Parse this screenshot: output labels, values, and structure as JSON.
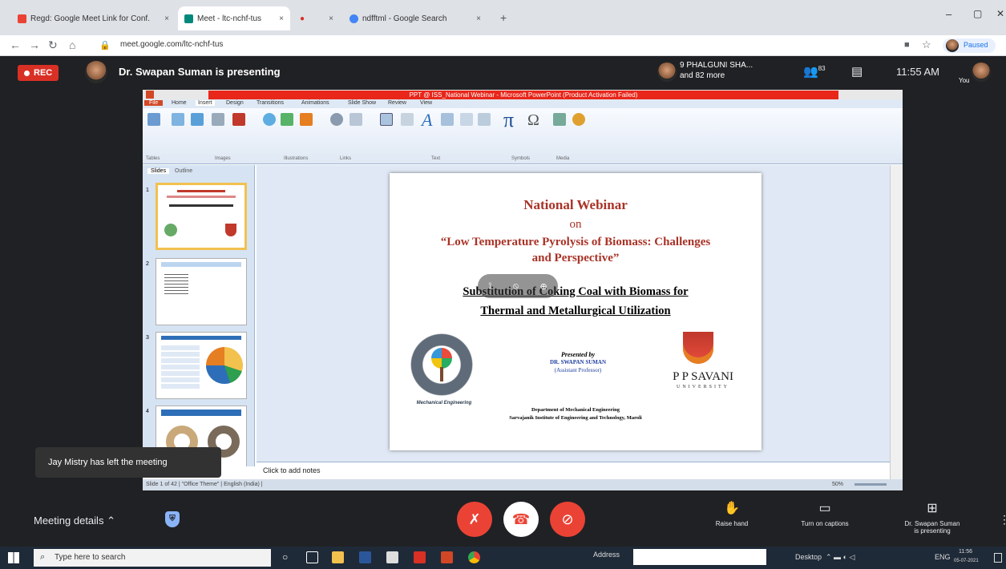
{
  "browser": {
    "tabs": [
      {
        "label": "Regd: Google Meet Link for Conf.",
        "close": "×"
      },
      {
        "label": "Meet - ltc-nchf-tus",
        "close": "×"
      },
      {
        "label": "●",
        "close": "×"
      },
      {
        "label": "ndfftml - Google Search",
        "close": "×"
      }
    ],
    "new_tab": "+",
    "url": "meet.google.com/ltc-nchf-tus",
    "paused_label": "Paused",
    "window_controls": [
      "–",
      "▢",
      "✕"
    ]
  },
  "meet": {
    "rec_label": "REC",
    "presenter_title": "Dr. Swapan Suman is presenting",
    "participants": {
      "line1": "9 PHALGUNI SHA...",
      "line2": "and 82 more"
    },
    "people_count": "83",
    "time": "11:55 AM",
    "you_label": "You",
    "toast": "Jay Mistry has left the meeting",
    "meeting_details": "Meeting details",
    "actions": [
      {
        "label": "Raise hand",
        "icon": "hand-icon"
      },
      {
        "label": "Turn on captions",
        "icon": "captions-icon"
      },
      {
        "label": "Dr. Swapan Suman",
        "label2": "is presenting",
        "icon": "present-icon"
      }
    ]
  },
  "ppt": {
    "window_title": "PPT @ ISS_National Webinar - Microsoft PowerPoint (Product Activation Failed)",
    "tabs": [
      "File",
      "Home",
      "Insert",
      "Design",
      "Transitions",
      "Animations",
      "Slide Show",
      "Review",
      "View"
    ],
    "ribbon_groups": [
      "Tables",
      "Images",
      "Illustrations",
      "Links",
      "Text",
      "Symbols",
      "Media"
    ],
    "ribbon_items": [
      "Table",
      "Picture",
      "Clip Art",
      "Screenshot",
      "Photo Album",
      "Shapes",
      "SmartArt",
      "Chart",
      "Hyperlink",
      "Action",
      "Text Box",
      "Header & Footer",
      "WordArt",
      "Date & Time",
      "Slide Number",
      "Object",
      "Equation",
      "Symbol",
      "Video",
      "Audio"
    ],
    "pane_tabs": [
      "Slides",
      "Outline"
    ],
    "thumb_numbers": [
      "1",
      "2",
      "3",
      "4"
    ],
    "notes_placeholder": "Click to add notes",
    "status": "Slide 1 of 42 | \"Office Theme\" | English (India) |",
    "zoom": "50%"
  },
  "slide": {
    "title": "National Webinar",
    "on": "on",
    "topic_line1": "“Low Temperature Pyrolysis of Biomass: Challenges",
    "topic_line2": "and Perspective”",
    "sub_line1": "Substitution of Coking Coal with Biomass for",
    "sub_line2": "Thermal and Metallurgical Utilization",
    "presented_by": "Presented by",
    "presenter": "DR. SWAPAN SUMAN",
    "designation": "(Assistant Professor)",
    "university": "P P SAVANI",
    "university_sub": "UNIVERSITY",
    "dept": "Department of Mechanical Engineering",
    "institute": "Sarvajanik Institute of Engineering and Technology, Maroli",
    "logo_caption": "Mechanical Engineering"
  },
  "taskbar": {
    "search_placeholder": "Type here to search",
    "address_label": "Address",
    "desktop_label": "Desktop",
    "lang": "ENG",
    "time": "11:56",
    "date": "05-07-2021"
  }
}
